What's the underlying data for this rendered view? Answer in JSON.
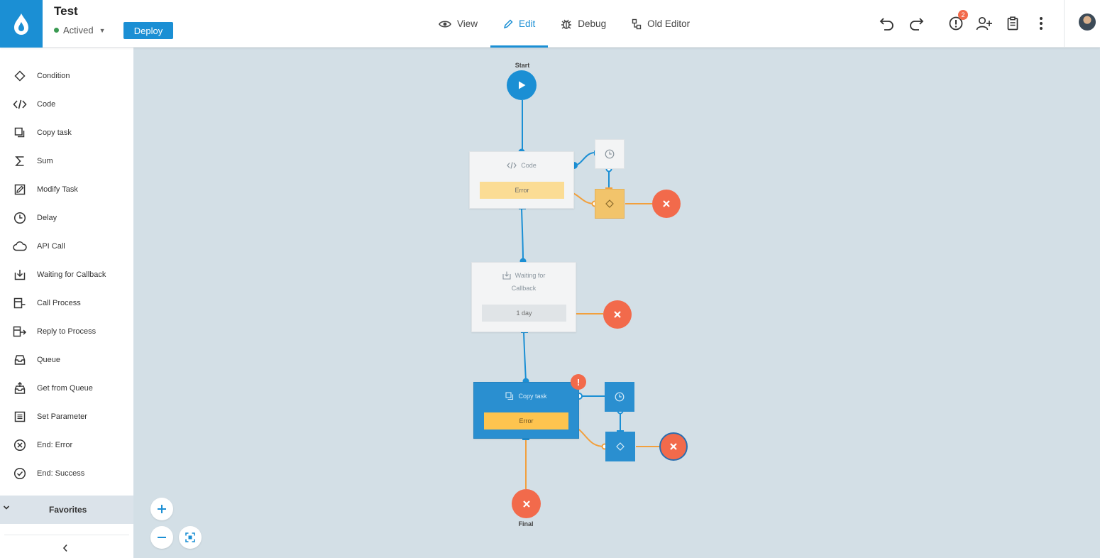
{
  "header": {
    "process_title": "Test",
    "status_label": "Actived",
    "deploy_label": "Deploy",
    "modes": [
      {
        "label": "View",
        "icon": "eye-icon"
      },
      {
        "label": "Edit",
        "icon": "pencil-icon",
        "active": true
      },
      {
        "label": "Debug",
        "icon": "bug-icon"
      },
      {
        "label": "Old Editor",
        "icon": "old-editor-icon"
      }
    ],
    "notification_count": "2"
  },
  "sidebar": {
    "items": [
      {
        "label": "Condition",
        "icon": "condition-icon"
      },
      {
        "label": "Code",
        "icon": "code-icon"
      },
      {
        "label": "Copy task",
        "icon": "copy-task-icon"
      },
      {
        "label": "Sum",
        "icon": "sum-icon"
      },
      {
        "label": "Modify Task",
        "icon": "modify-task-icon"
      },
      {
        "label": "Delay",
        "icon": "delay-icon"
      },
      {
        "label": "API Call",
        "icon": "cloud-icon"
      },
      {
        "label": "Waiting for Callback",
        "icon": "callback-icon"
      },
      {
        "label": "Call Process",
        "icon": "call-process-icon"
      },
      {
        "label": "Reply to Process",
        "icon": "reply-process-icon"
      },
      {
        "label": "Queue",
        "icon": "queue-icon"
      },
      {
        "label": "Get from Queue",
        "icon": "get-queue-icon"
      },
      {
        "label": "Set Parameter",
        "icon": "set-parameter-icon"
      },
      {
        "label": "End: Error",
        "icon": "end-error-icon"
      },
      {
        "label": "End: Success",
        "icon": "end-success-icon"
      }
    ],
    "favorites_label": "Favorites"
  },
  "canvas": {
    "start_label": "Start",
    "final_label": "Final",
    "code_node": {
      "title": "Code",
      "error_label": "Error"
    },
    "callback_node": {
      "title_line1": "Waiting for",
      "title_line2": "Callback",
      "timeout_label": "1 day"
    },
    "copy_node": {
      "title": "Copy task",
      "error_label": "Error",
      "warning_mark": "!"
    }
  },
  "colors": {
    "accent": "#1b8fd4",
    "error": "#f26a4b",
    "link_blue": "#1b8fd4",
    "link_orange": "#f2a03d",
    "canvas_bg": "#d3dfe6"
  }
}
